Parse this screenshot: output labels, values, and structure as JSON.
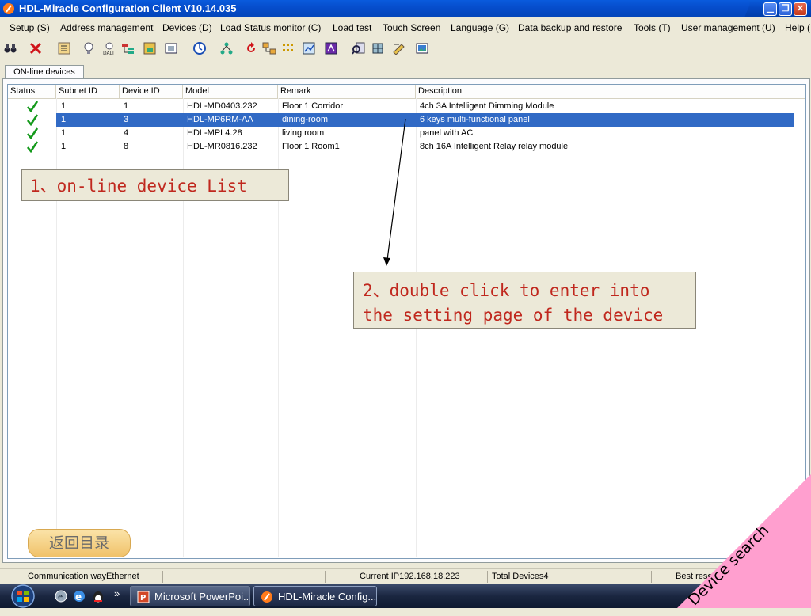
{
  "window": {
    "title": "HDL-Miracle Configuration Client V10.14.035",
    "controls": [
      "minimize-icon",
      "restore-icon",
      "close-icon"
    ]
  },
  "menu": [
    "Setup (S)",
    "Address management",
    "Devices (D)",
    "Load Status monitor (C)",
    "Load test",
    "Touch Screen",
    "Language (G)",
    "Data backup and restore",
    "Tools (T)",
    "User management (U)",
    "Help ("
  ],
  "toolbar_icons": [
    "binoculars-icon",
    "delete-icon",
    "list-icon",
    "bulb-icon",
    "dali-icon",
    "tree-icon",
    "image-icon",
    "window-icon",
    "clock-icon",
    "network-icon",
    "refresh-icon",
    "connect-icon",
    "grid-icon",
    "chart-icon",
    "purple-icon",
    "search-device-icon",
    "tool-icon",
    "edit-icon",
    "picture-icon"
  ],
  "tab": {
    "label": "ON-line devices"
  },
  "table": {
    "columns": [
      "Status",
      "Subnet ID",
      "Device ID",
      "Model",
      "Remark",
      "Description"
    ],
    "rows": [
      {
        "subnet": "1",
        "device": "1",
        "model": "HDL-MD0403.232",
        "remark": "Floor 1 Corridor",
        "description": "4ch 3A Intelligent Dimming Module",
        "selected": false
      },
      {
        "subnet": "1",
        "device": "3",
        "model": "HDL-MP6RM-AA",
        "remark": "dining-room",
        "description": "6 keys multi-functional panel",
        "selected": true
      },
      {
        "subnet": "1",
        "device": "4",
        "model": "HDL-MPL4.28",
        "remark": "living room",
        "description": "panel with AC",
        "selected": false
      },
      {
        "subnet": "1",
        "device": "8",
        "model": "HDL-MR0816.232",
        "remark": "Floor 1 Room1",
        "description": "8ch 16A Intelligent Relay relay module",
        "selected": false
      }
    ]
  },
  "annotations": {
    "note1": "1、on-line device List",
    "note2_line1": "2、double click to enter into",
    "note2_line2": "the setting page of the device"
  },
  "back_button": "返回目录",
  "status": {
    "comm": "Communication wayEthernet",
    "ip": "Current IP192.168.18.223",
    "total": "Total Devices4",
    "best": "Best resol"
  },
  "taskbar": {
    "chevron": "»",
    "tasks": [
      {
        "label": "Microsoft PowerPoi...",
        "icon": "powerpoint-icon"
      },
      {
        "label": "HDL-Miracle Config...",
        "icon": "hdl-app-icon"
      }
    ]
  },
  "ribbon": {
    "label": "Device search",
    "color": "#ff9fcf"
  },
  "colors": {
    "selection": "#316ac5",
    "note_text": "#c0281e",
    "titlebar": "#0549c4"
  }
}
